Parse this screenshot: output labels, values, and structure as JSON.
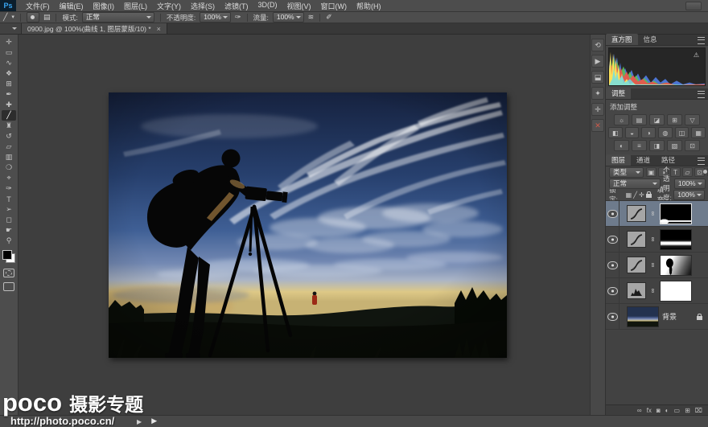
{
  "app": {
    "logo": "Ps"
  },
  "menu": {
    "items": [
      "文件(F)",
      "编辑(E)",
      "图像(I)",
      "图层(L)",
      "文字(Y)",
      "选择(S)",
      "滤镜(T)",
      "3D(D)",
      "视图(V)",
      "窗口(W)",
      "帮助(H)"
    ]
  },
  "options_bar": {
    "mode_label": "模式:",
    "mode_value": "正常",
    "opacity_label": "不透明度:",
    "opacity_value": "100%",
    "flow_label": "流量:",
    "flow_value": "100%"
  },
  "document_tab": {
    "title": "0900.jpg @ 100%(曲线 1, 图层蒙版/10) *",
    "close": "×"
  },
  "toolbar": {
    "tools": [
      {
        "name": "move-tool",
        "glyph": "✛"
      },
      {
        "name": "marquee-tool",
        "glyph": "▭"
      },
      {
        "name": "lasso-tool",
        "glyph": "∿"
      },
      {
        "name": "quick-select-tool",
        "glyph": "❖"
      },
      {
        "name": "crop-tool",
        "glyph": "⊞"
      },
      {
        "name": "eyedropper-tool",
        "glyph": "✒"
      },
      {
        "name": "healing-brush-tool",
        "glyph": "✚"
      },
      {
        "name": "brush-tool",
        "glyph": "╱",
        "active": true
      },
      {
        "name": "clone-stamp-tool",
        "glyph": "♜"
      },
      {
        "name": "history-brush-tool",
        "glyph": "↺"
      },
      {
        "name": "eraser-tool",
        "glyph": "▱"
      },
      {
        "name": "gradient-tool",
        "glyph": "▥"
      },
      {
        "name": "blur-tool",
        "glyph": "❍"
      },
      {
        "name": "dodge-tool",
        "glyph": "⌖"
      },
      {
        "name": "pen-tool",
        "glyph": "✑"
      },
      {
        "name": "type-tool",
        "glyph": "T"
      },
      {
        "name": "path-select-tool",
        "glyph": "➢"
      },
      {
        "name": "shape-tool",
        "glyph": "◻"
      },
      {
        "name": "hand-tool",
        "glyph": "☛"
      },
      {
        "name": "zoom-tool",
        "glyph": "⚲"
      }
    ]
  },
  "dock_strip": {
    "icons": [
      {
        "name": "history-panel-icon",
        "glyph": "⟲"
      },
      {
        "name": "actions-panel-icon",
        "glyph": "▶"
      },
      {
        "name": "properties-panel-icon",
        "glyph": "⬓"
      },
      {
        "name": "brush-presets-panel-icon",
        "glyph": "✦"
      },
      {
        "name": "add-panel-icon",
        "glyph": "✛"
      },
      {
        "name": "close-panel-icon",
        "glyph": "✕",
        "color": "#d05a4a"
      }
    ]
  },
  "panels": {
    "histogram": {
      "tabs": [
        {
          "label": "直方图",
          "active": true
        },
        {
          "label": "信息",
          "active": false
        }
      ]
    },
    "adjustments": {
      "tab": "调整",
      "hint": "添加调整",
      "rows": [
        [
          {
            "name": "brightness-contrast",
            "glyph": "☼"
          },
          {
            "name": "levels",
            "glyph": "▤"
          },
          {
            "name": "curves",
            "glyph": "◪"
          },
          {
            "name": "exposure",
            "glyph": "⊞"
          },
          {
            "name": "vibrance",
            "glyph": "▽"
          }
        ],
        [
          {
            "name": "hue-saturation",
            "glyph": "◧"
          },
          {
            "name": "color-balance",
            "glyph": "◒"
          },
          {
            "name": "black-white",
            "glyph": "◑"
          },
          {
            "name": "photo-filter",
            "glyph": "◍"
          },
          {
            "name": "channel-mixer",
            "glyph": "◫"
          },
          {
            "name": "color-lookup",
            "glyph": "▦"
          }
        ],
        [
          {
            "name": "invert",
            "glyph": "◐"
          },
          {
            "name": "posterize",
            "glyph": "≡"
          },
          {
            "name": "threshold",
            "glyph": "◨"
          },
          {
            "name": "gradient-map",
            "glyph": "▧"
          },
          {
            "name": "selective-color",
            "glyph": "⊡"
          }
        ]
      ]
    },
    "layers": {
      "tabs": [
        {
          "label": "图层",
          "active": true
        },
        {
          "label": "通道",
          "active": false
        },
        {
          "label": "路径",
          "active": false
        }
      ],
      "filter_label": "类型",
      "filter_icons": [
        {
          "name": "filter-pixel-icon",
          "glyph": "▣"
        },
        {
          "name": "filter-adjustment-icon",
          "glyph": "◑"
        },
        {
          "name": "filter-type-icon",
          "glyph": "T"
        },
        {
          "name": "filter-shape-icon",
          "glyph": "▱"
        },
        {
          "name": "filter-smart-object-icon",
          "glyph": "⊡"
        }
      ],
      "blend_mode": "正常",
      "opacity_label": "不透明度:",
      "opacity_value": "100%",
      "lock_label": "锁定:",
      "lock_icons": [
        {
          "name": "lock-transparent-icon",
          "glyph": "▦"
        },
        {
          "name": "lock-pixels-icon",
          "glyph": "╱"
        },
        {
          "name": "lock-position-icon",
          "glyph": "✛"
        },
        {
          "name": "lock-all-icon",
          "glyph": "LOCK"
        }
      ],
      "fill_label": "填充:",
      "fill_value": "100%",
      "items": [
        {
          "kind": "curves",
          "mask": "mask-dark-bottom",
          "selected": true
        },
        {
          "kind": "curves",
          "mask": "mask-band",
          "selected": false
        },
        {
          "kind": "curves",
          "mask": "mask-diagonal",
          "selected": false
        },
        {
          "kind": "levels",
          "mask": "mask-white",
          "selected": false
        },
        {
          "kind": "background",
          "label": "背景",
          "locked": true
        }
      ],
      "bottom_icons": [
        {
          "name": "link-layers-icon",
          "glyph": "∞"
        },
        {
          "name": "layer-style-icon",
          "glyph": "fx"
        },
        {
          "name": "add-mask-icon",
          "glyph": "◙"
        },
        {
          "name": "new-adjustment-layer-icon",
          "glyph": "◐"
        },
        {
          "name": "new-group-icon",
          "glyph": "▭"
        },
        {
          "name": "new-layer-icon",
          "glyph": "⊞"
        },
        {
          "name": "delete-layer-icon",
          "glyph": "⌧"
        }
      ]
    }
  },
  "statusbar": {
    "scroll_glyph": "▶"
  },
  "watermark": {
    "brand": "poco",
    "title": "摄影专题",
    "url": "http://photo.poco.cn/",
    "arrow": "▶"
  },
  "colors": {
    "selected_layer": "#6e7b8c",
    "logo_blue": "#39a6f2",
    "close_red": "#d05a4a"
  }
}
